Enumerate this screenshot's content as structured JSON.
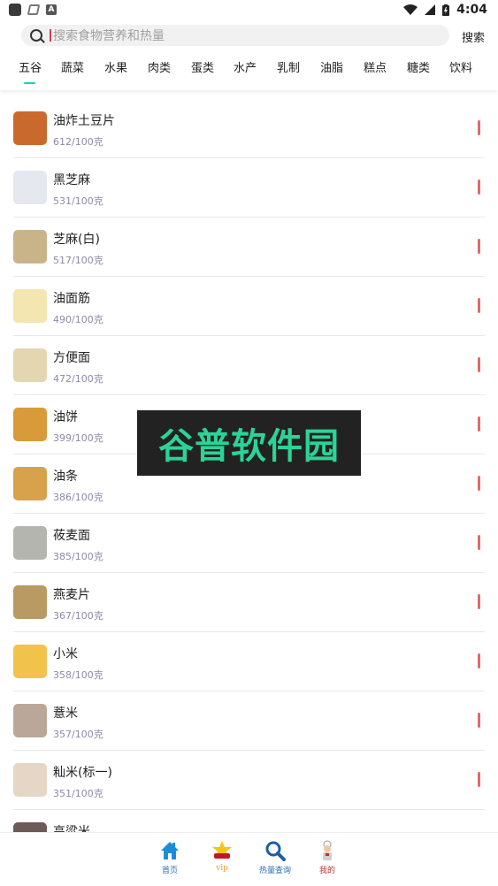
{
  "status_bar": {
    "time": "4:04"
  },
  "search": {
    "placeholder": "搜索食物营养和热量",
    "button_label": "搜索"
  },
  "tabs": [
    {
      "label": "五谷",
      "active": true
    },
    {
      "label": "蔬菜"
    },
    {
      "label": "水果"
    },
    {
      "label": "肉类"
    },
    {
      "label": "蛋类"
    },
    {
      "label": "水产"
    },
    {
      "label": "乳制"
    },
    {
      "label": "油脂"
    },
    {
      "label": "糕点"
    },
    {
      "label": "糖类"
    },
    {
      "label": "饮料"
    }
  ],
  "foods": [
    {
      "name": "油炸土豆片",
      "calories": "612/100克",
      "color": "#c96a2c"
    },
    {
      "name": "黑芝麻",
      "calories": "531/100克",
      "color": "#e6e8f0"
    },
    {
      "name": "芝麻(白)",
      "calories": "517/100克",
      "color": "#c9b48a"
    },
    {
      "name": "油面筋",
      "calories": "490/100克",
      "color": "#f3e6b0"
    },
    {
      "name": "方便面",
      "calories": "472/100克",
      "color": "#e4d6b0"
    },
    {
      "name": "油饼",
      "calories": "399/100克",
      "color": "#d99a3a"
    },
    {
      "name": "油条",
      "calories": "386/100克",
      "color": "#d8a24c"
    },
    {
      "name": "莜麦面",
      "calories": "385/100克",
      "color": "#b5b5b0"
    },
    {
      "name": "燕麦片",
      "calories": "367/100克",
      "color": "#b99a63"
    },
    {
      "name": "小米",
      "calories": "358/100克",
      "color": "#f2c34a"
    },
    {
      "name": "薏米",
      "calories": "357/100克",
      "color": "#bba79a"
    },
    {
      "name": "籼米(标一)",
      "calories": "351/100克",
      "color": "#e6d6c6"
    },
    {
      "name": "高粱米",
      "calories": "",
      "color": "#6a5a58"
    }
  ],
  "watermark": "谷普软件园",
  "bottom_nav": [
    {
      "label": "首页"
    },
    {
      "label": "vip"
    },
    {
      "label": "热量查询"
    },
    {
      "label": "我的"
    }
  ],
  "colors": {
    "accent": "#2cc7b8",
    "calorie_bar": "#e06b6b",
    "calorie_text": "#8c8aa8"
  }
}
